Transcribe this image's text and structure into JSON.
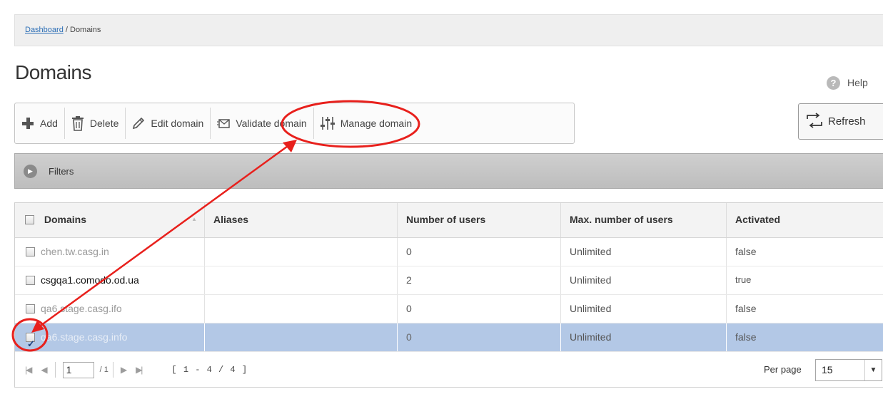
{
  "breadcrumb": {
    "link": "Dashboard",
    "separator": " / ",
    "current": "Domains"
  },
  "page": {
    "title": "Domains"
  },
  "help": {
    "label": "Help"
  },
  "toolbar": {
    "add": "Add",
    "delete": "Delete",
    "edit": "Edit domain",
    "validate": "Validate domain",
    "manage": "Manage domain"
  },
  "refresh": {
    "label": "Refresh"
  },
  "filters": {
    "label": "Filters"
  },
  "table": {
    "columns": [
      "Domains",
      "Aliases",
      "Number of users",
      "Max. number of users",
      "Activated"
    ],
    "rows": [
      {
        "domain": "chen.tw.casg.in",
        "aliases": "",
        "users": "0",
        "max_users": "Unlimited",
        "activated": "false",
        "checked": false
      },
      {
        "domain": "csgqa1.comodo.od.ua",
        "aliases": "",
        "users": "2",
        "max_users": "Unlimited",
        "activated": "true",
        "checked": false
      },
      {
        "domain": "qa6.stage.casg.ifo",
        "aliases": "",
        "users": "0",
        "max_users": "Unlimited",
        "activated": "false",
        "checked": false
      },
      {
        "domain": "qa6.stage.casg.info",
        "aliases": "",
        "users": "0",
        "max_users": "Unlimited",
        "activated": "false",
        "checked": true
      }
    ]
  },
  "pager": {
    "page_value": "1",
    "page_total": "/ 1",
    "range": "[ 1 - 4 / 4 ]",
    "per_page_label": "Per page",
    "per_page_value": "15"
  },
  "colors": {
    "annotation": "#e8201c",
    "selected_row": "#b3c8e6",
    "link": "#2a6db5"
  }
}
